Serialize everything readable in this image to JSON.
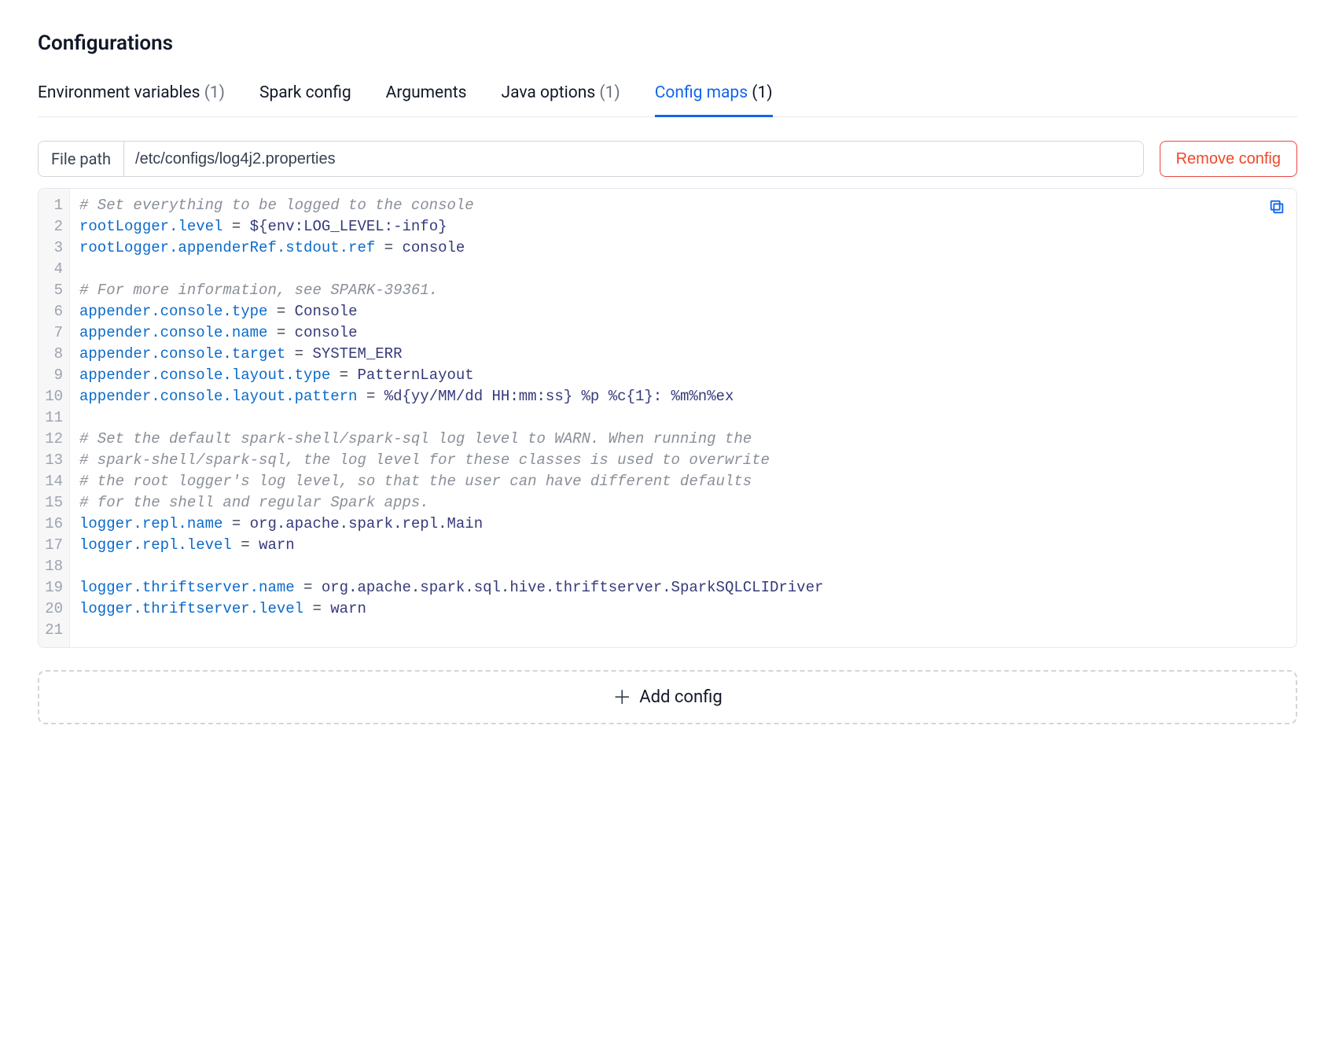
{
  "title": "Configurations",
  "tabs": [
    {
      "label": "Environment variables",
      "count": "(1)",
      "active": false
    },
    {
      "label": "Spark config",
      "count": "",
      "active": false
    },
    {
      "label": "Arguments",
      "count": "",
      "active": false
    },
    {
      "label": "Java options",
      "count": "(1)",
      "active": false
    },
    {
      "label": "Config maps",
      "count": "(1)",
      "active": true
    }
  ],
  "filepath": {
    "label": "File path",
    "value": "/etc/configs/log4j2.properties"
  },
  "buttons": {
    "remove": "Remove config",
    "add": "Add config"
  },
  "code": {
    "lines": [
      {
        "n": 1,
        "type": "comment",
        "text": "# Set everything to be logged to the console"
      },
      {
        "n": 2,
        "type": "kv",
        "key": "rootLogger.level",
        "eq": " = ",
        "val": "${env:LOG_LEVEL:-info}"
      },
      {
        "n": 3,
        "type": "kv",
        "key": "rootLogger.appenderRef.stdout.ref",
        "eq": " = ",
        "val": "console"
      },
      {
        "n": 4,
        "type": "blank",
        "text": ""
      },
      {
        "n": 5,
        "type": "comment",
        "text": "# For more information, see SPARK-39361."
      },
      {
        "n": 6,
        "type": "kv",
        "key": "appender.console.type",
        "eq": " = ",
        "val": "Console"
      },
      {
        "n": 7,
        "type": "kv",
        "key": "appender.console.name",
        "eq": " = ",
        "val": "console"
      },
      {
        "n": 8,
        "type": "kv",
        "key": "appender.console.target",
        "eq": " = ",
        "val": "SYSTEM_ERR"
      },
      {
        "n": 9,
        "type": "kv",
        "key": "appender.console.layout.type",
        "eq": " = ",
        "val": "PatternLayout"
      },
      {
        "n": 10,
        "type": "kv",
        "key": "appender.console.layout.pattern",
        "eq": " = ",
        "val": "%d{yy/MM/dd HH:mm:ss} %p %c{1}: %m%n%ex"
      },
      {
        "n": 11,
        "type": "blank",
        "text": ""
      },
      {
        "n": 12,
        "type": "comment",
        "text": "# Set the default spark-shell/spark-sql log level to WARN. When running the"
      },
      {
        "n": 13,
        "type": "comment",
        "text": "# spark-shell/spark-sql, the log level for these classes is used to overwrite"
      },
      {
        "n": 14,
        "type": "comment",
        "text": "# the root logger's log level, so that the user can have different defaults"
      },
      {
        "n": 15,
        "type": "comment",
        "text": "# for the shell and regular Spark apps."
      },
      {
        "n": 16,
        "type": "kv",
        "key": "logger.repl.name",
        "eq": " = ",
        "val": "org.apache.spark.repl.Main"
      },
      {
        "n": 17,
        "type": "kv",
        "key": "logger.repl.level",
        "eq": " = ",
        "val": "warn"
      },
      {
        "n": 18,
        "type": "blank",
        "text": ""
      },
      {
        "n": 19,
        "type": "kv",
        "key": "logger.thriftserver.name",
        "eq": " = ",
        "val": "org.apache.spark.sql.hive.thriftserver.SparkSQLCLIDriver"
      },
      {
        "n": 20,
        "type": "kv",
        "key": "logger.thriftserver.level",
        "eq": " = ",
        "val": "warn"
      },
      {
        "n": 21,
        "type": "blank",
        "text": ""
      }
    ]
  }
}
